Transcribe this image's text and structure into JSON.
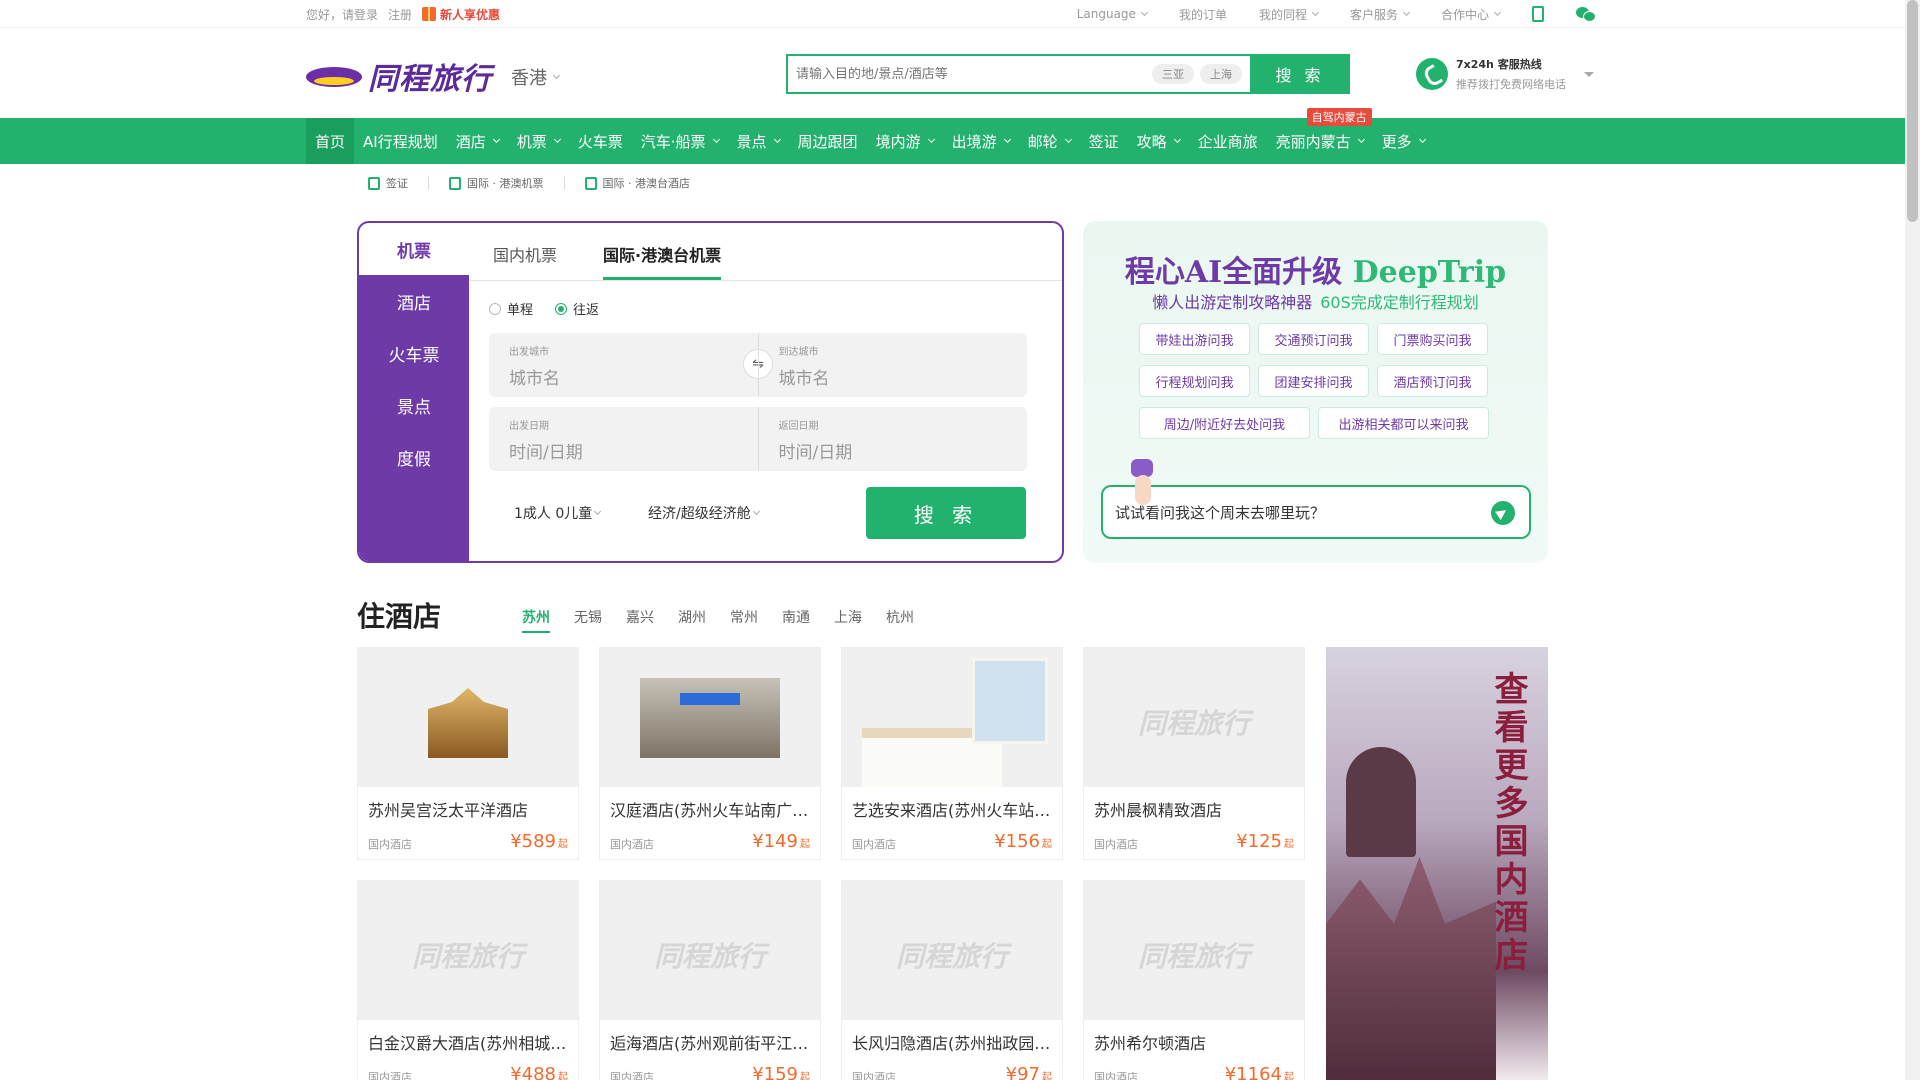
{
  "topbar": {
    "greeting": "您好，请登录",
    "register": "注册",
    "promo": "新人享优惠",
    "language": "Language",
    "orders": "我的订单",
    "trips": "我的同程",
    "service": "客户服务",
    "partner": "合作中心"
  },
  "header": {
    "logo_text": "同程旅行",
    "city": "香港",
    "search": {
      "placeholder": "请输入目的地/景点/酒店等",
      "tags": [
        "三亚",
        "上海"
      ],
      "button": "搜 索"
    },
    "hotline": {
      "title": "7x24h 客服热线",
      "subtitle": "推荐拨打免费网络电话"
    }
  },
  "nav": {
    "items": [
      {
        "label": "首页"
      },
      {
        "label": "AI行程规划"
      },
      {
        "label": "酒店"
      },
      {
        "label": "机票"
      },
      {
        "label": "火车票"
      },
      {
        "label": "汽车·船票"
      },
      {
        "label": "景点"
      },
      {
        "label": "周边跟团"
      },
      {
        "label": "境内游"
      },
      {
        "label": "出境游"
      },
      {
        "label": "邮轮"
      },
      {
        "label": "签证"
      },
      {
        "label": "攻略"
      },
      {
        "label": "企业商旅"
      },
      {
        "label": "亮丽内蒙古",
        "badge": "自驾内蒙古"
      },
      {
        "label": "更多"
      }
    ]
  },
  "quick": {
    "items": [
      "签证",
      "国际 · 港澳机票",
      "国际 · 港澳台酒店"
    ]
  },
  "booking": {
    "side_tabs": [
      "机票",
      "酒店",
      "火车票",
      "景点",
      "度假"
    ],
    "tabs": [
      "国内机票",
      "国际·港澳台机票"
    ],
    "trip_types": [
      "单程",
      "往返"
    ],
    "from_label": "出发城市",
    "from_placeholder": "城市名",
    "to_label": "到达城市",
    "to_placeholder": "城市名",
    "depart_label": "出发日期",
    "depart_placeholder": "时间/日期",
    "return_label": "返回日期",
    "return_placeholder": "时间/日期",
    "passengers": "1成人 0儿童",
    "cabin": "经济/超级经济舱",
    "search_button": "搜 索"
  },
  "ai": {
    "title_a": "程心AI全面升级",
    "title_b": "DeepTrip",
    "sub_a": "懒人出游定制攻略神器",
    "sub_b": "60S完成定制行程规划",
    "chips": [
      "带娃出游问我",
      "交通预订问我",
      "门票购买问我",
      "行程规划问我",
      "团建安排问我",
      "酒店预订问我",
      "周边/附近好去处问我",
      "出游相关都可以来问我"
    ],
    "ask_placeholder": "试试看问我这个周末去哪里玩？"
  },
  "hotels": {
    "title": "住酒店",
    "cities": [
      "苏州",
      "无锡",
      "嘉兴",
      "湖州",
      "常州",
      "南通",
      "上海",
      "杭州"
    ],
    "suffix": "起",
    "cards": [
      {
        "name": "苏州吴宫泛太平洋酒店",
        "type": "国内酒店",
        "price": "¥589"
      },
      {
        "name": "汉庭酒店(苏州火车站南广场店)",
        "type": "国内酒店",
        "price": "¥149"
      },
      {
        "name": "艺选安来酒店(苏州火车站店)",
        "type": "国内酒店",
        "price": "¥156"
      },
      {
        "name": "苏州晨枫精致酒店",
        "type": "国内酒店",
        "price": "¥125"
      },
      {
        "name": "白金汉爵大酒店(苏州相城店)",
        "type": "国内酒店",
        "price": "¥488"
      },
      {
        "name": "逅海酒店(苏州观前街平江路店)",
        "type": "国内酒店",
        "price": "¥159"
      },
      {
        "name": "长风归隐酒店(苏州拙政园店)",
        "type": "国内酒店",
        "price": "¥97"
      },
      {
        "name": "苏州希尔顿酒店",
        "type": "国内酒店",
        "price": "¥1164"
      }
    ],
    "banner": "查看更多国内酒店"
  }
}
